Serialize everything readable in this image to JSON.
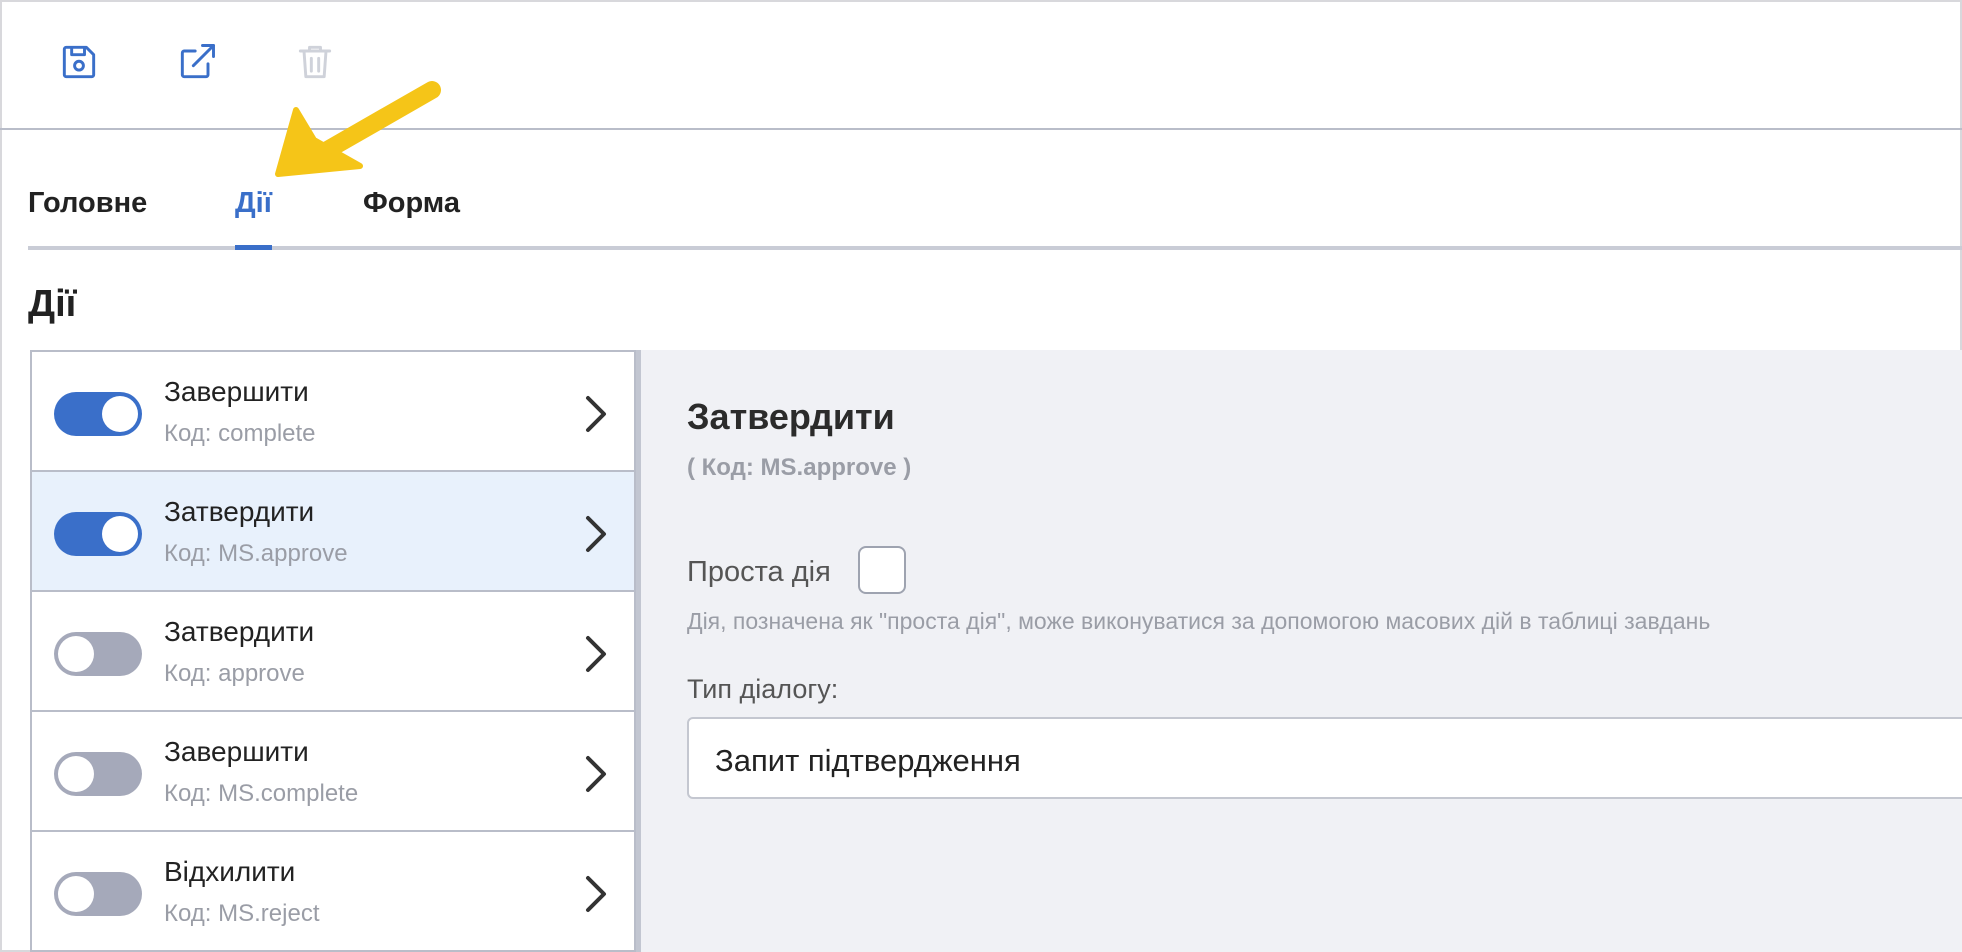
{
  "toolbar": {
    "save_icon": "save-icon",
    "open_icon": "external-link-icon",
    "delete_icon": "trash-icon"
  },
  "tabs": [
    {
      "label": "Головне",
      "active": false
    },
    {
      "label": "Дії",
      "active": true
    },
    {
      "label": "Форма",
      "active": false
    }
  ],
  "section": {
    "title": "Дії"
  },
  "actions": [
    {
      "title": "Завершити",
      "code": "Код: complete",
      "enabled": true,
      "selected": false
    },
    {
      "title": "Затвердити",
      "code": "Код: MS.approve",
      "enabled": true,
      "selected": true
    },
    {
      "title": "Затвердити",
      "code": "Код: approve",
      "enabled": false,
      "selected": false
    },
    {
      "title": "Завершити",
      "code": "Код: MS.complete",
      "enabled": false,
      "selected": false
    },
    {
      "title": "Відхилити",
      "code": "Код: MS.reject",
      "enabled": false,
      "selected": false
    }
  ],
  "detail": {
    "title": "Затвердити",
    "code": "( Код: MS.approve )",
    "simple_action_label": "Проста дія",
    "simple_action_checked": false,
    "simple_action_hint": "Дія, позначена як \"проста дія\", може виконуватися за допомогою масових дій в таблиці завдань",
    "dialog_type_label": "Тип діалогу:",
    "dialog_type_value": "Запит підтвердження"
  },
  "colors": {
    "accent": "#3a6fc9",
    "selected_row": "#e8f1fc",
    "toggle_off": "#a5a9ba",
    "panel_bg": "#f0f1f5",
    "annotation_arrow": "#f5c518"
  }
}
